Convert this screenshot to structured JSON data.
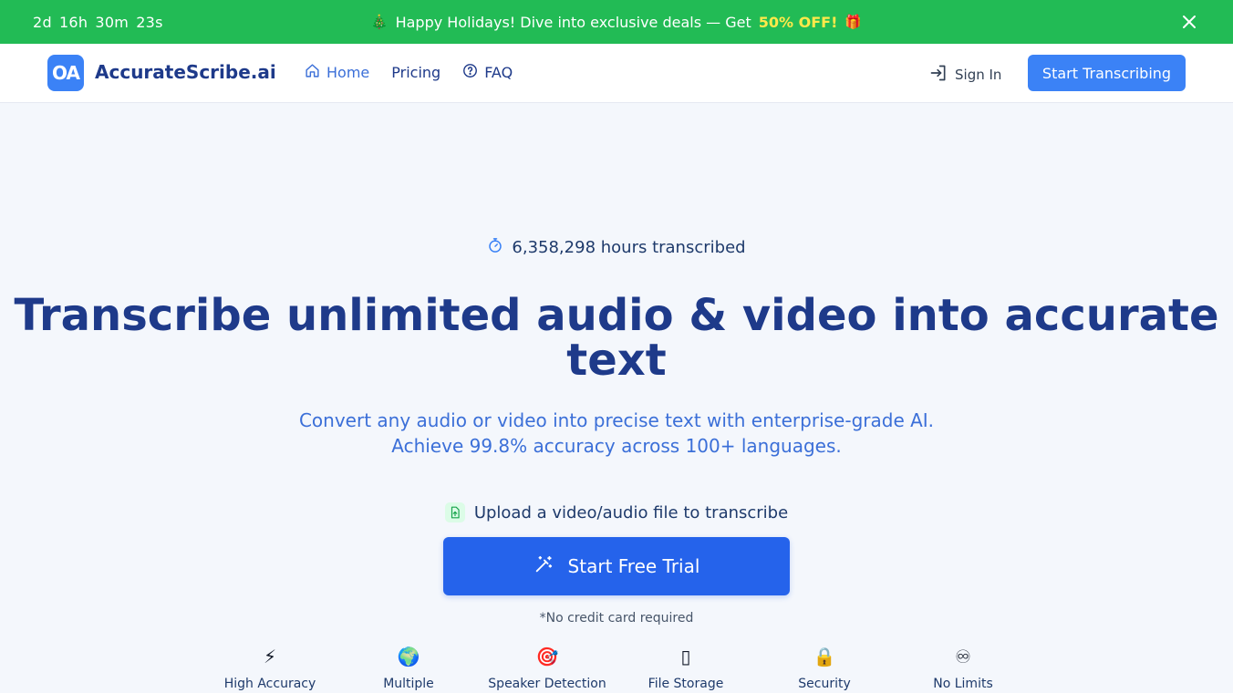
{
  "promo": {
    "countdown": {
      "days": "2d",
      "hours": "16h",
      "minutes": "30m",
      "seconds": "23s"
    },
    "tree_emoji": "🎄",
    "message": "Happy Holidays! Dive into exclusive deals — Get",
    "highlight": "50% OFF!",
    "gift_emoji": "🎁",
    "bg_color": "#22bb55",
    "highlight_color": "#ffe94a"
  },
  "header": {
    "logo_mark": "OA",
    "brand": "AccurateScribe.ai",
    "nav": [
      {
        "label": "Home",
        "icon": "home-icon",
        "active": true
      },
      {
        "label": "Pricing"
      },
      {
        "label": "FAQ",
        "icon": "help-circle-icon"
      }
    ],
    "sign_in": "Sign In",
    "cta": "Start Transcribing",
    "accent_color": "#3b82f6"
  },
  "hero": {
    "hours_count": "6,358,298 hours transcribed",
    "headline": "Transcribe unlimited audio & video into accurate text",
    "subline_1": "Convert any audio or video into precise text with enterprise-grade AI.",
    "subline_2": "Achieve 99.8% accuracy across 100+ languages.",
    "upload_label": "Upload a video/audio file to transcribe",
    "trial_button": "Start Free Trial",
    "no_card": "*No credit card required"
  },
  "features": [
    {
      "icon": "⚡",
      "icon_name": "lightning-icon",
      "label": "High Accuracy"
    },
    {
      "icon": "🌍",
      "icon_name": "globe-icon",
      "label": "Multiple"
    },
    {
      "icon": "🎯",
      "icon_name": "target-icon",
      "label": "Speaker Detection"
    },
    {
      "icon": "▯",
      "icon_name": "file-storage-icon",
      "label": "File Storage"
    },
    {
      "icon": "🔒",
      "icon_name": "lock-icon",
      "label": "Security"
    },
    {
      "icon": "♾",
      "icon_name": "infinity-icon",
      "label": "No Limits"
    }
  ]
}
